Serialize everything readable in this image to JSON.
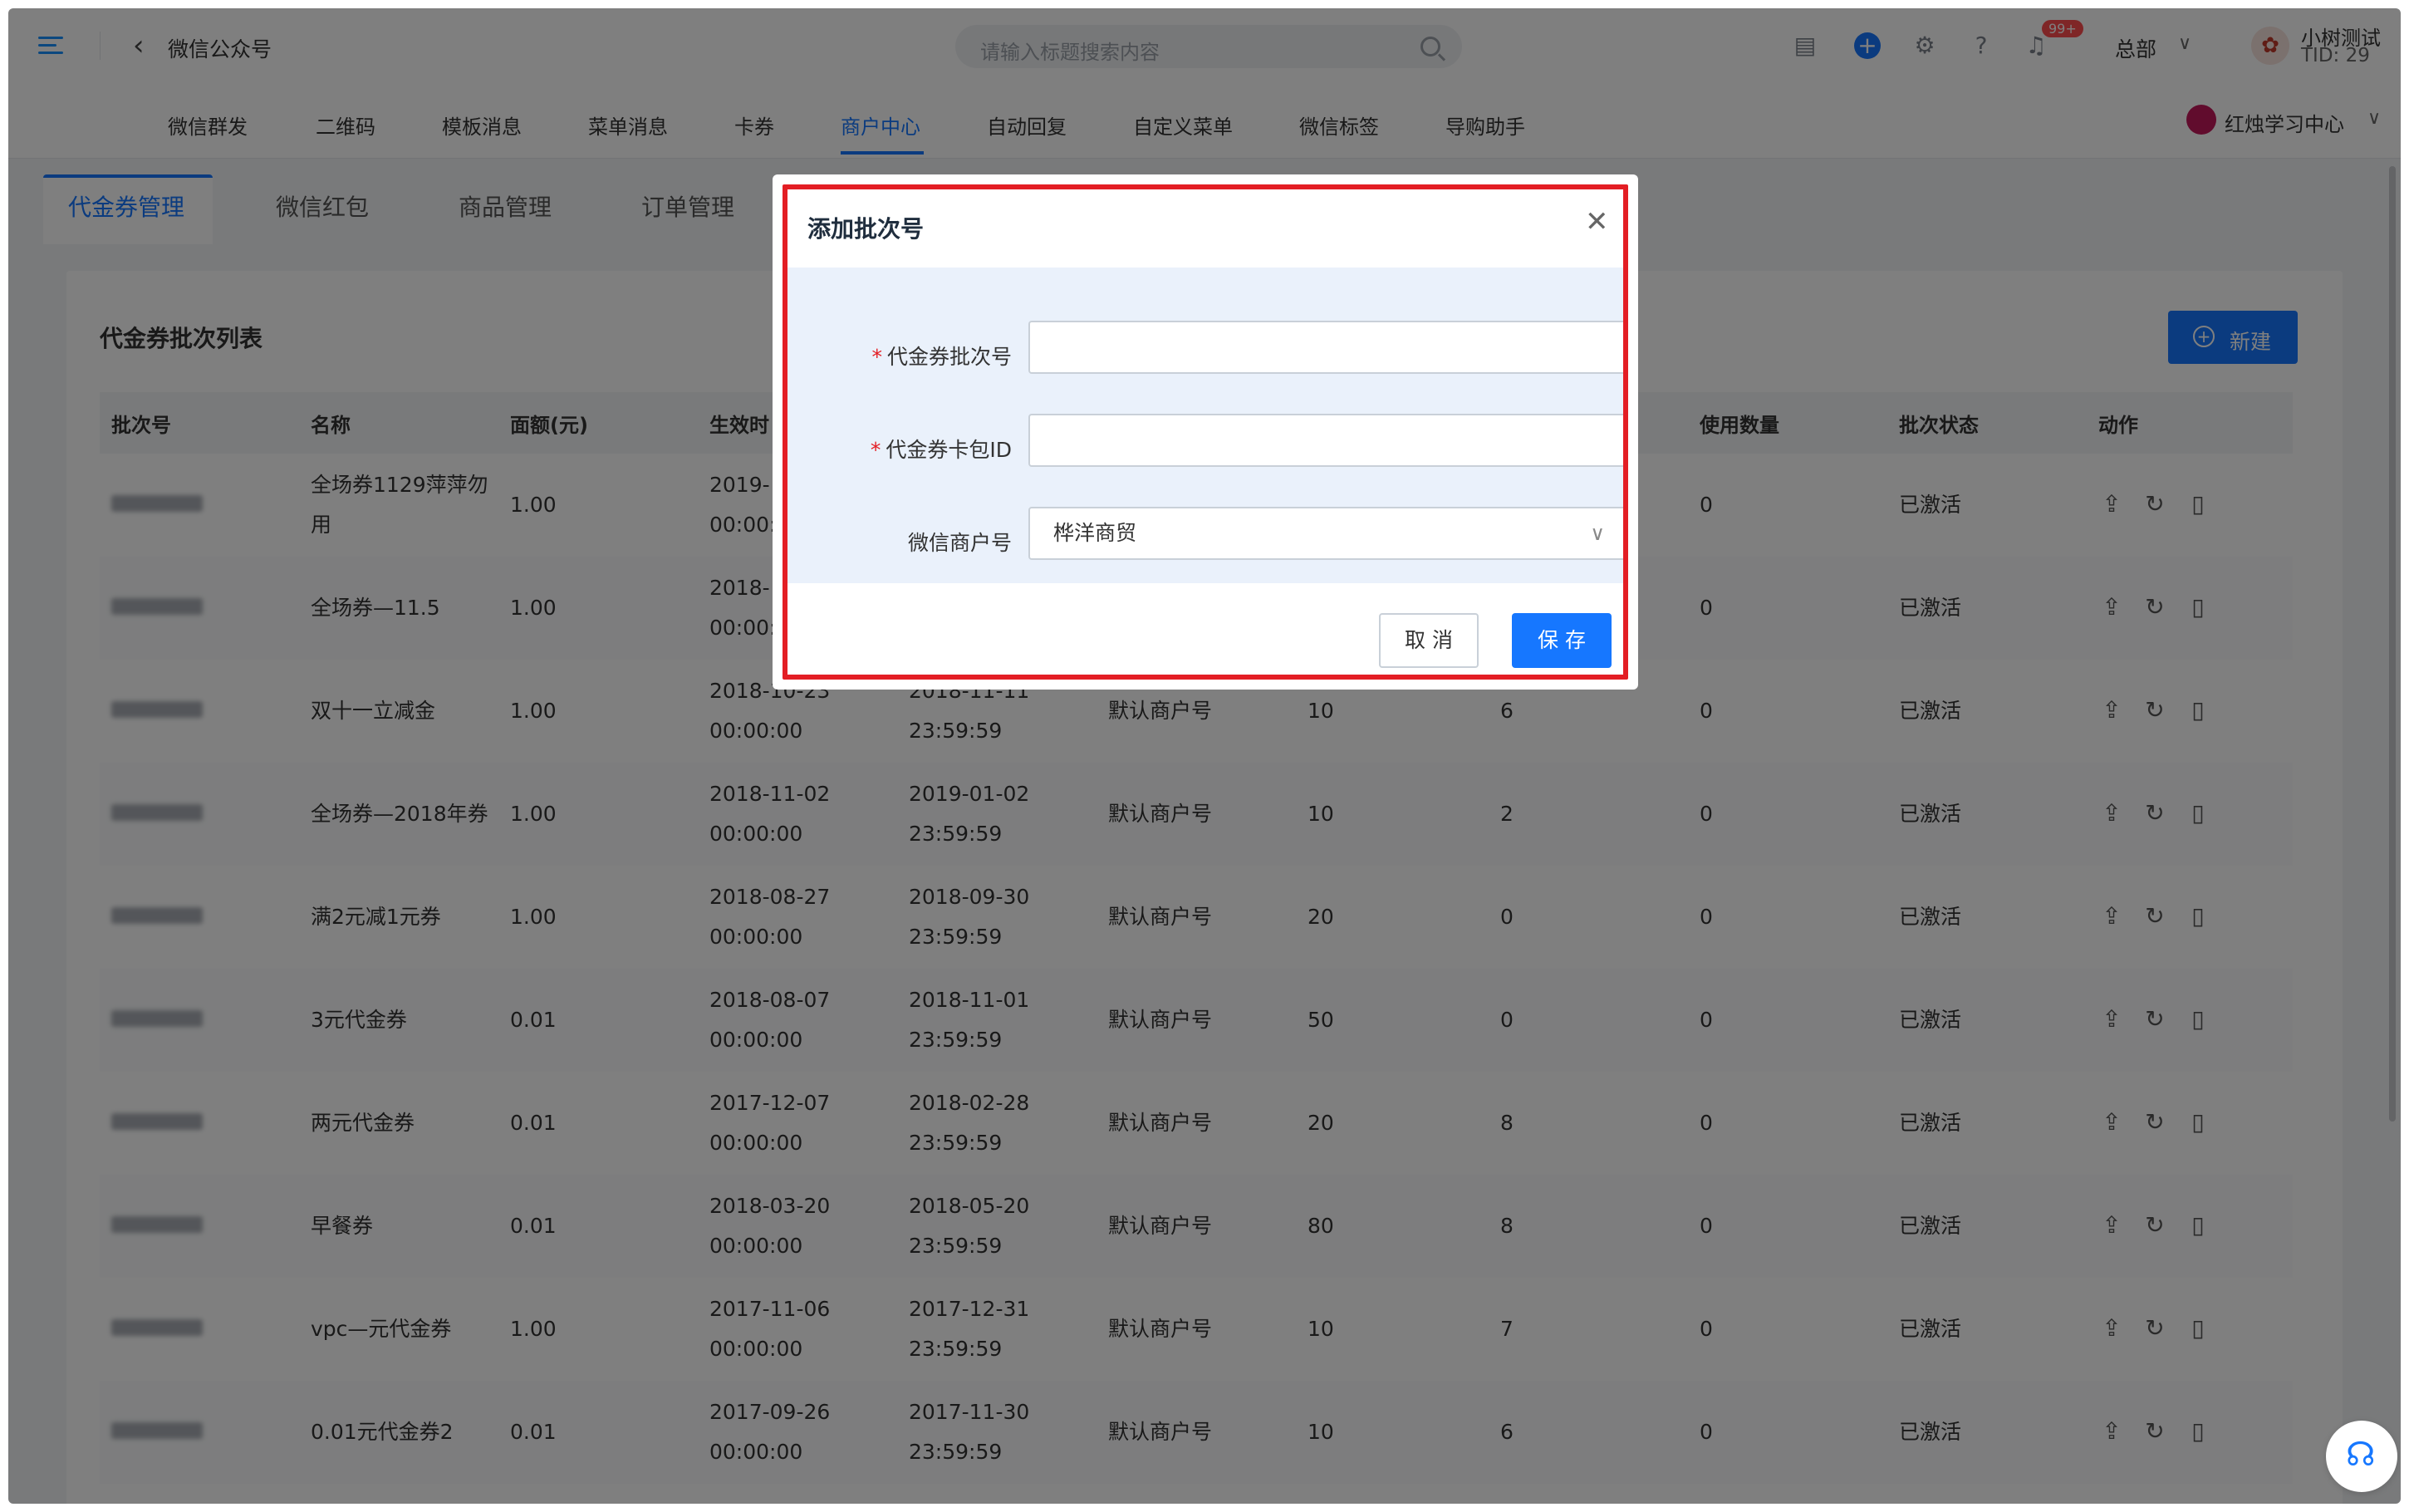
{
  "header": {
    "app_title": "微信公众号",
    "back_icon": "chevron-left-icon",
    "search_placeholder": "请输入标题搜索内容",
    "notification_badge": "99+",
    "branch": "总部",
    "user_name": "小树测试",
    "user_tid": "TID: 29"
  },
  "nav": {
    "items": [
      "微信群发",
      "二维码",
      "模板消息",
      "菜单消息",
      "卡券",
      "商户中心",
      "自动回复",
      "自定义菜单",
      "微信标签",
      "导购助手"
    ],
    "active": "商户中心",
    "org_name": "红烛学习中心"
  },
  "subtabs": {
    "items": [
      "代金券管理",
      "微信红包",
      "商品管理",
      "订单管理"
    ],
    "active": "代金券管理"
  },
  "list": {
    "title": "代金券批次列表",
    "new_button": "新建",
    "columns": [
      "批次号",
      "名称",
      "面额(元)",
      "生效时",
      "",
      "",
      "",
      "",
      "使用数量",
      "批次状态",
      "动作"
    ],
    "rows": [
      {
        "name": "全场券1129萍萍勿用",
        "amount": "1.00",
        "start": "2019-",
        "start_time": "00:00:",
        "end": "",
        "end_time": "",
        "merchant": "",
        "total": "",
        "received": "",
        "used": "0",
        "status": "已激活"
      },
      {
        "name": "全场券—11.5",
        "amount": "1.00",
        "start": "2018-",
        "start_time": "00:00:",
        "end": "",
        "end_time": "",
        "merchant": "",
        "total": "",
        "received": "",
        "used": "0",
        "status": "已激活"
      },
      {
        "name": "双十一立减金",
        "amount": "1.00",
        "start": "2018-10-23",
        "start_time": "00:00:00",
        "end": "2018-11-11",
        "end_time": "23:59:59",
        "merchant": "默认商户号",
        "total": "10",
        "received": "6",
        "used": "0",
        "status": "已激活"
      },
      {
        "name": "全场券—2018年券",
        "amount": "1.00",
        "start": "2018-11-02",
        "start_time": "00:00:00",
        "end": "2019-01-02",
        "end_time": "23:59:59",
        "merchant": "默认商户号",
        "total": "10",
        "received": "2",
        "used": "0",
        "status": "已激活"
      },
      {
        "name": "满2元减1元券",
        "amount": "1.00",
        "start": "2018-08-27",
        "start_time": "00:00:00",
        "end": "2018-09-30",
        "end_time": "23:59:59",
        "merchant": "默认商户号",
        "total": "20",
        "received": "0",
        "used": "0",
        "status": "已激活"
      },
      {
        "name": "3元代金券",
        "amount": "0.01",
        "start": "2018-08-07",
        "start_time": "00:00:00",
        "end": "2018-11-01",
        "end_time": "23:59:59",
        "merchant": "默认商户号",
        "total": "50",
        "received": "0",
        "used": "0",
        "status": "已激活"
      },
      {
        "name": "两元代金券",
        "amount": "0.01",
        "start": "2017-12-07",
        "start_time": "00:00:00",
        "end": "2018-02-28",
        "end_time": "23:59:59",
        "merchant": "默认商户号",
        "total": "20",
        "received": "8",
        "used": "0",
        "status": "已激活"
      },
      {
        "name": "早餐券",
        "amount": "0.01",
        "start": "2018-03-20",
        "start_time": "00:00:00",
        "end": "2018-05-20",
        "end_time": "23:59:59",
        "merchant": "默认商户号",
        "total": "80",
        "received": "8",
        "used": "0",
        "status": "已激活"
      },
      {
        "name": "vpc—元代金券",
        "amount": "1.00",
        "start": "2017-11-06",
        "start_time": "00:00:00",
        "end": "2017-12-31",
        "end_time": "23:59:59",
        "merchant": "默认商户号",
        "total": "10",
        "received": "7",
        "used": "0",
        "status": "已激活"
      },
      {
        "name": "0.01元代金券2",
        "amount": "0.01",
        "start": "2017-09-26",
        "start_time": "00:00:00",
        "end": "2017-11-30",
        "end_time": "23:59:59",
        "merchant": "默认商户号",
        "total": "10",
        "received": "6",
        "used": "0",
        "status": "已激活"
      }
    ],
    "row_actions": [
      "upload-icon",
      "refresh-icon",
      "trash-icon"
    ]
  },
  "modal": {
    "title": "添加批次号",
    "fields": [
      {
        "label": "代金券批次号",
        "required": true,
        "value": "",
        "type": "text"
      },
      {
        "label": "代金券卡包ID",
        "required": true,
        "value": "",
        "type": "text"
      },
      {
        "label": "微信商户号",
        "required": false,
        "value": "桦洋商贸",
        "type": "select"
      }
    ],
    "cancel_label": "取 消",
    "save_label": "保 存",
    "highlight_color": "#e31e24"
  },
  "colors": {
    "accent": "#1677ff",
    "overlay": "rgba(0,0,0,0.5)",
    "highlight": "#e31e24"
  }
}
